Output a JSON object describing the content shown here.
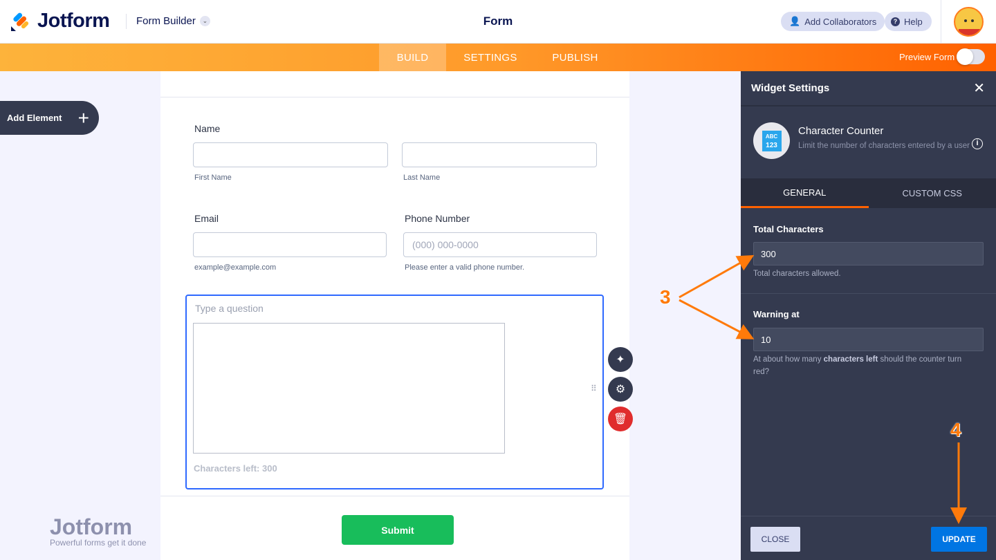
{
  "header": {
    "brand": "Jotform",
    "mode": "Form Builder",
    "title": "Form",
    "add_collaborators": "Add Collaborators",
    "help": "Help"
  },
  "nav": {
    "tabs": [
      "BUILD",
      "SETTINGS",
      "PUBLISH"
    ],
    "active": "BUILD",
    "preview_label": "Preview Form",
    "preview_on": false
  },
  "sidebar": {
    "add_element": "Add Element"
  },
  "form": {
    "name_label": "Name",
    "first_name": "First Name",
    "last_name": "Last Name",
    "email_label": "Email",
    "email_sub": "example@example.com",
    "phone_label": "Phone Number",
    "phone_placeholder": "(000) 000-0000",
    "phone_sub": "Please enter a valid phone number.",
    "question_placeholder": "Type a question",
    "chars_left": "Characters left: 300",
    "submit": "Submit"
  },
  "watermark": {
    "brand": "Jotform",
    "tagline": "Powerful forms get it done"
  },
  "panel": {
    "title": "Widget Settings",
    "widget_name": "Character Counter",
    "widget_desc": "Limit the number of characters entered by a user",
    "widget_icon_text": [
      "ABC",
      "123"
    ],
    "tabs": [
      "GENERAL",
      "CUSTOM CSS"
    ],
    "total_label": "Total Characters",
    "total_value": "300",
    "total_hint": "Total characters allowed.",
    "warning_label": "Warning at",
    "warning_value": "10",
    "warning_hint_pre": "At about how many ",
    "warning_hint_bold": "characters left",
    "warning_hint_post": " should the counter turn red?",
    "close": "CLOSE",
    "update": "UPDATE"
  },
  "annotations": [
    "3",
    "4"
  ],
  "colors": {
    "accent": "#ff6100",
    "panel": "#343a4f",
    "update": "#0075e3",
    "submit": "#18bd5b"
  }
}
